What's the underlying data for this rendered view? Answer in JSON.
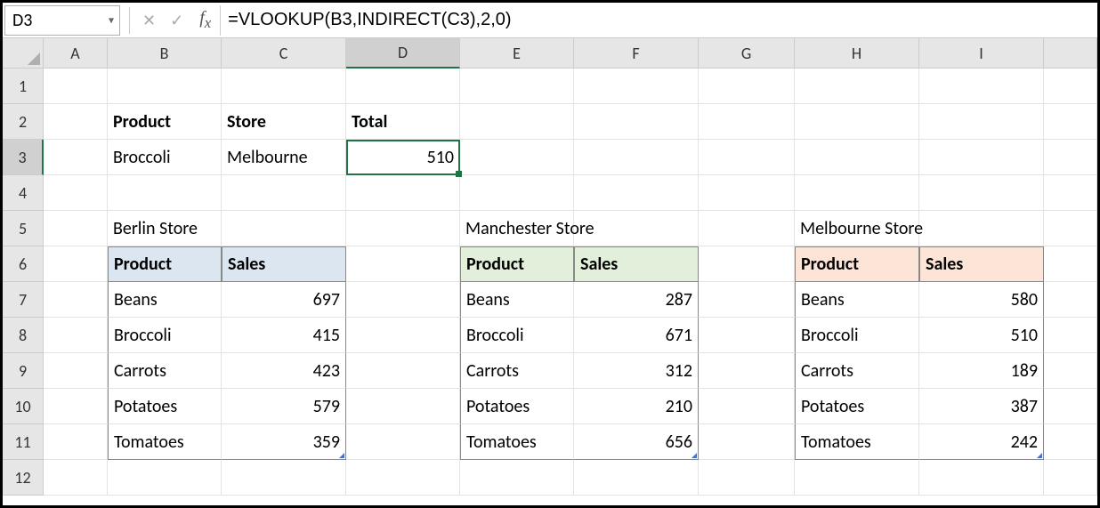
{
  "name_box": "D3",
  "formula": "=VLOOKUP(B3,INDIRECT(C3),2,0)",
  "columns": [
    "A",
    "B",
    "C",
    "D",
    "E",
    "F",
    "G",
    "H",
    "I"
  ],
  "rows": [
    "1",
    "2",
    "3",
    "4",
    "5",
    "6",
    "7",
    "8",
    "9",
    "10",
    "11",
    "12"
  ],
  "active_col": "D",
  "active_row": "3",
  "lookup": {
    "h_product": "Product",
    "h_store": "Store",
    "h_total": "Total",
    "product": "Broccoli",
    "store": "Melbourne",
    "total": "510"
  },
  "stores": {
    "berlin": {
      "title": "Berlin Store",
      "h1": "Product",
      "h2": "Sales",
      "rows": [
        {
          "p": "Beans",
          "s": "697"
        },
        {
          "p": "Broccoli",
          "s": "415"
        },
        {
          "p": "Carrots",
          "s": "423"
        },
        {
          "p": "Potatoes",
          "s": "579"
        },
        {
          "p": "Tomatoes",
          "s": "359"
        }
      ]
    },
    "manchester": {
      "title": "Manchester Store",
      "h1": "Product",
      "h2": "Sales",
      "rows": [
        {
          "p": "Beans",
          "s": "287"
        },
        {
          "p": "Broccoli",
          "s": "671"
        },
        {
          "p": "Carrots",
          "s": "312"
        },
        {
          "p": "Potatoes",
          "s": "210"
        },
        {
          "p": "Tomatoes",
          "s": "656"
        }
      ]
    },
    "melbourne": {
      "title": "Melbourne Store",
      "h1": "Product",
      "h2": "Sales",
      "rows": [
        {
          "p": "Beans",
          "s": "580"
        },
        {
          "p": "Broccoli",
          "s": "510"
        },
        {
          "p": "Carrots",
          "s": "189"
        },
        {
          "p": "Potatoes",
          "s": "387"
        },
        {
          "p": "Tomatoes",
          "s": "242"
        }
      ]
    }
  }
}
